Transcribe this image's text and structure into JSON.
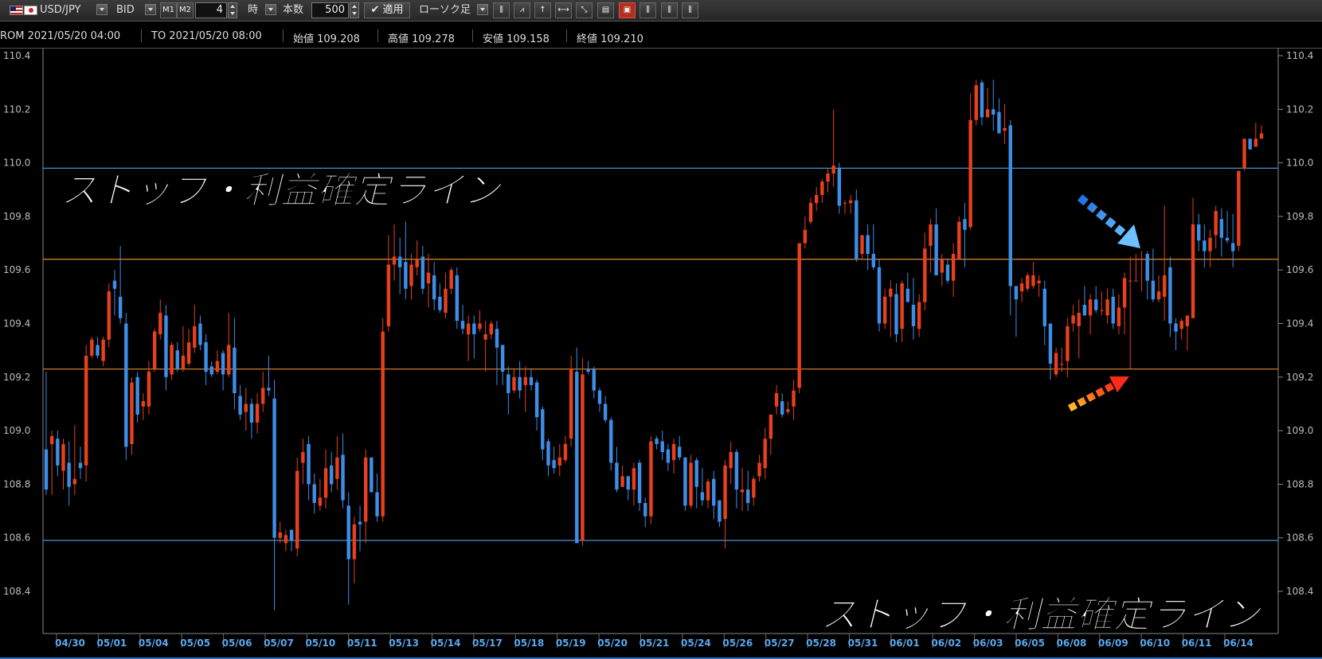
{
  "toolbar": {
    "pair": "USD/JPY",
    "price_type": "BID",
    "m1_label": "M1",
    "m2_label": "M2",
    "period_value": "4",
    "period_unit": "時",
    "count_label": "本数",
    "count_value": "500",
    "apply_label": "✔ 適用",
    "chart_type": "ローソク足"
  },
  "info": {
    "from": "ROM  2021/05/20 04:00",
    "to": "TO  2021/05/20 08:00",
    "open": "始値 109.208",
    "high": "高値 109.278",
    "low": "安値 109.158",
    "close": "終値 109.210"
  },
  "colors": {
    "up": "#e8401c",
    "down": "#3d8ee8",
    "hline_blue": "#4aa6e6",
    "hline_orange": "#e58a2a",
    "axis_text": "#bbbbbb",
    "date_text": "#5aa8ee"
  },
  "chart_data": {
    "type": "candlestick",
    "ylim": [
      108.3,
      110.4
    ],
    "y_ticks": [
      "110.4",
      "110.2",
      "110.0",
      "109.8",
      "109.6",
      "109.4",
      "109.2",
      "109.0",
      "108.8",
      "108.6",
      "108.4"
    ],
    "y_tick_values": [
      110.4,
      110.2,
      110.0,
      109.8,
      109.6,
      109.4,
      109.2,
      109.0,
      108.8,
      108.6,
      108.4
    ],
    "x_labels": [
      "04/30",
      "05/01",
      "05/04",
      "05/05",
      "05/06",
      "05/07",
      "05/10",
      "05/11",
      "05/13",
      "05/14",
      "05/17",
      "05/18",
      "05/19",
      "05/20",
      "05/21",
      "05/24",
      "05/26",
      "05/27",
      "05/28",
      "05/31",
      "06/01",
      "06/02",
      "06/03",
      "06/05",
      "06/08",
      "06/09",
      "06/10",
      "06/11",
      "06/14"
    ],
    "hlines": [
      {
        "y": 109.98,
        "color": "blue"
      },
      {
        "y": 109.64,
        "color": "orange"
      },
      {
        "y": 109.23,
        "color": "orange"
      },
      {
        "y": 108.59,
        "color": "blue"
      }
    ],
    "annotations": [
      {
        "text": "ストップ・利益確定ライン",
        "position": "top-left"
      },
      {
        "text": "ストップ・利益確定ライン",
        "position": "bottom-right"
      }
    ],
    "candles": [
      [
        108.93,
        108.78,
        109.22,
        108.76
      ],
      [
        108.95,
        108.98,
        109.0,
        108.76
      ],
      [
        108.97,
        108.87,
        109.0,
        108.83
      ],
      [
        108.85,
        108.95,
        108.97,
        108.78
      ],
      [
        108.88,
        108.79,
        108.96,
        108.72
      ],
      [
        108.8,
        108.82,
        109.02,
        108.76
      ],
      [
        108.88,
        108.86,
        108.94,
        108.82
      ],
      [
        108.87,
        109.28,
        109.32,
        108.81
      ],
      [
        109.28,
        109.34,
        109.35,
        109.27
      ],
      [
        109.32,
        109.28,
        109.35,
        109.27
      ],
      [
        109.26,
        109.34,
        109.35,
        109.24
      ],
      [
        109.34,
        109.52,
        109.55,
        109.31
      ],
      [
        109.56,
        109.53,
        109.6,
        109.43
      ],
      [
        109.5,
        109.42,
        109.69,
        109.4
      ],
      [
        109.4,
        108.94,
        109.44,
        108.89
      ],
      [
        108.95,
        109.18,
        109.2,
        108.91
      ],
      [
        109.2,
        109.06,
        109.22,
        109.03
      ],
      [
        109.09,
        109.11,
        109.14,
        109.04
      ],
      [
        109.09,
        109.22,
        109.26,
        109.06
      ],
      [
        109.23,
        109.37,
        109.38,
        109.22
      ],
      [
        109.36,
        109.44,
        109.49,
        109.34
      ],
      [
        109.43,
        109.2,
        109.47,
        109.15
      ],
      [
        109.21,
        109.32,
        109.33,
        109.19
      ],
      [
        109.3,
        109.23,
        109.33,
        109.22
      ],
      [
        109.23,
        109.28,
        109.39,
        109.22
      ],
      [
        109.25,
        109.33,
        109.38,
        109.24
      ],
      [
        109.31,
        109.39,
        109.47,
        109.29
      ],
      [
        109.4,
        109.32,
        109.43,
        109.3
      ],
      [
        109.33,
        109.22,
        109.36,
        109.17
      ],
      [
        109.24,
        109.21,
        109.26,
        109.2
      ],
      [
        109.22,
        109.26,
        109.3,
        109.21
      ],
      [
        109.29,
        109.21,
        109.3,
        109.15
      ],
      [
        109.21,
        109.32,
        109.44,
        109.2
      ],
      [
        109.31,
        109.14,
        109.42,
        109.08
      ],
      [
        109.13,
        109.06,
        109.17,
        109.04
      ],
      [
        109.07,
        109.1,
        109.16,
        109.0
      ],
      [
        109.1,
        109.03,
        109.12,
        108.97
      ],
      [
        109.03,
        109.1,
        109.14,
        108.99
      ],
      [
        109.1,
        109.16,
        109.22,
        109.07
      ],
      [
        109.16,
        109.15,
        109.28,
        109.13
      ],
      [
        109.12,
        108.6,
        109.19,
        108.33
      ],
      [
        108.6,
        108.62,
        108.66,
        108.58
      ],
      [
        108.58,
        108.61,
        108.63,
        108.55
      ],
      [
        108.63,
        108.59,
        108.63,
        108.55
      ],
      [
        108.56,
        108.85,
        108.9,
        108.53
      ],
      [
        108.88,
        108.92,
        108.97,
        108.8
      ],
      [
        108.95,
        108.8,
        108.98,
        108.74
      ],
      [
        108.8,
        108.73,
        108.84,
        108.69
      ],
      [
        108.72,
        108.75,
        108.82,
        108.7
      ],
      [
        108.75,
        108.86,
        108.93,
        108.71
      ],
      [
        108.87,
        108.8,
        108.92,
        108.77
      ],
      [
        108.82,
        108.9,
        108.98,
        108.78
      ],
      [
        108.91,
        108.74,
        108.99,
        108.71
      ],
      [
        108.72,
        108.52,
        108.77,
        108.35
      ],
      [
        108.52,
        108.65,
        108.68,
        108.43
      ],
      [
        108.66,
        108.65,
        108.72,
        108.55
      ],
      [
        108.66,
        108.9,
        108.93,
        108.58
      ],
      [
        108.9,
        108.77,
        108.9,
        108.77
      ],
      [
        108.77,
        108.68,
        108.84,
        108.66
      ],
      [
        108.68,
        109.37,
        109.42,
        108.66
      ],
      [
        109.39,
        109.62,
        109.73,
        109.37
      ],
      [
        109.62,
        109.65,
        109.77,
        109.56
      ],
      [
        109.65,
        109.61,
        109.72,
        109.51
      ],
      [
        109.63,
        109.53,
        109.78,
        109.49
      ],
      [
        109.54,
        109.62,
        109.66,
        109.49
      ],
      [
        109.61,
        109.64,
        109.71,
        109.58
      ],
      [
        109.65,
        109.53,
        109.69,
        109.51
      ],
      [
        109.55,
        109.59,
        109.66,
        109.46
      ],
      [
        109.58,
        109.49,
        109.63,
        109.45
      ],
      [
        109.5,
        109.45,
        109.55,
        109.44
      ],
      [
        109.44,
        109.53,
        109.59,
        109.42
      ],
      [
        109.53,
        109.6,
        109.61,
        109.51
      ],
      [
        109.58,
        109.41,
        109.61,
        109.38
      ],
      [
        109.41,
        109.38,
        109.47,
        109.36
      ],
      [
        109.36,
        109.4,
        109.43,
        109.26
      ],
      [
        109.4,
        109.36,
        109.43,
        109.27
      ],
      [
        109.38,
        109.4,
        109.45,
        109.37
      ],
      [
        109.34,
        109.36,
        109.41,
        109.22
      ],
      [
        109.36,
        109.4,
        109.41,
        109.34
      ],
      [
        109.38,
        109.31,
        109.41,
        109.17
      ],
      [
        109.32,
        109.22,
        109.31,
        109.17
      ],
      [
        109.21,
        109.14,
        109.24,
        109.06
      ],
      [
        109.15,
        109.2,
        109.23,
        109.14
      ],
      [
        109.2,
        109.15,
        109.26,
        109.12
      ],
      [
        109.17,
        109.2,
        109.24,
        109.07
      ],
      [
        109.2,
        109.17,
        109.23,
        109.15
      ],
      [
        109.18,
        109.05,
        109.19,
        109.0
      ],
      [
        109.08,
        108.93,
        109.09,
        108.89
      ],
      [
        108.96,
        108.87,
        108.97,
        108.83
      ],
      [
        108.89,
        108.86,
        108.94,
        108.84
      ],
      [
        108.87,
        108.9,
        108.95,
        108.83
      ],
      [
        108.89,
        108.95,
        108.98,
        108.88
      ],
      [
        108.97,
        109.23,
        109.28,
        108.94
      ],
      [
        109.22,
        108.58,
        109.31,
        108.59
      ],
      [
        108.59,
        109.21,
        109.27,
        108.57
      ],
      [
        109.23,
        109.22,
        109.26,
        109.21
      ],
      [
        109.23,
        109.15,
        109.24,
        109.12
      ],
      [
        109.15,
        109.1,
        109.16,
        109.07
      ],
      [
        109.1,
        109.04,
        109.13,
        109.03
      ],
      [
        109.04,
        108.88,
        109.05,
        108.85
      ],
      [
        108.88,
        108.78,
        108.94,
        108.77
      ],
      [
        108.79,
        108.83,
        108.87,
        108.79
      ],
      [
        108.83,
        108.78,
        108.83,
        108.74
      ],
      [
        108.78,
        108.86,
        108.88,
        108.72
      ],
      [
        108.88,
        108.73,
        108.89,
        108.7
      ],
      [
        108.73,
        108.68,
        108.75,
        108.64
      ],
      [
        108.68,
        108.96,
        108.98,
        108.65
      ],
      [
        108.97,
        108.95,
        108.98,
        108.93
      ],
      [
        108.96,
        108.92,
        109.0,
        108.89
      ],
      [
        108.93,
        108.88,
        108.95,
        108.85
      ],
      [
        108.89,
        108.95,
        108.97,
        108.84
      ],
      [
        108.94,
        108.9,
        108.98,
        108.89
      ],
      [
        108.9,
        108.72,
        108.9,
        108.7
      ],
      [
        108.72,
        108.88,
        108.91,
        108.71
      ],
      [
        108.89,
        108.79,
        108.9,
        108.71
      ],
      [
        108.77,
        108.74,
        108.86,
        108.72
      ],
      [
        108.74,
        108.81,
        108.82,
        108.71
      ],
      [
        108.82,
        108.72,
        108.85,
        108.67
      ],
      [
        108.74,
        108.66,
        108.74,
        108.64
      ],
      [
        108.67,
        108.87,
        108.89,
        108.56
      ],
      [
        108.86,
        108.92,
        108.96,
        108.8
      ],
      [
        108.92,
        108.78,
        108.93,
        108.71
      ],
      [
        108.77,
        108.78,
        108.86,
        108.7
      ],
      [
        108.78,
        108.73,
        108.85,
        108.7
      ],
      [
        108.75,
        108.82,
        108.83,
        108.72
      ],
      [
        108.83,
        108.88,
        108.91,
        108.81
      ],
      [
        108.86,
        108.97,
        109.01,
        108.82
      ],
      [
        108.97,
        109.06,
        109.06,
        108.91
      ],
      [
        109.09,
        109.14,
        109.17,
        109.06
      ],
      [
        109.11,
        109.06,
        109.14,
        109.05
      ],
      [
        109.07,
        109.08,
        109.11,
        109.06
      ],
      [
        109.09,
        109.15,
        109.19,
        109.04
      ],
      [
        109.16,
        109.7,
        109.7,
        109.14
      ],
      [
        109.7,
        109.75,
        109.8,
        109.68
      ],
      [
        109.78,
        109.85,
        109.87,
        109.77
      ],
      [
        109.85,
        109.88,
        109.91,
        109.82
      ],
      [
        109.88,
        109.93,
        109.94,
        109.85
      ],
      [
        109.93,
        109.96,
        109.98,
        109.89
      ],
      [
        109.96,
        109.99,
        110.2,
        109.91
      ],
      [
        109.98,
        109.84,
        110.0,
        109.81
      ],
      [
        109.85,
        109.85,
        109.86,
        109.81
      ],
      [
        109.85,
        109.86,
        109.88,
        109.81
      ],
      [
        109.86,
        109.64,
        109.9,
        109.63
      ],
      [
        109.66,
        109.73,
        109.73,
        109.64
      ],
      [
        109.73,
        109.66,
        109.77,
        109.6
      ],
      [
        109.66,
        109.61,
        109.77,
        109.6
      ],
      [
        109.61,
        109.4,
        109.64,
        109.37
      ],
      [
        109.4,
        109.5,
        109.53,
        109.38
      ],
      [
        109.5,
        109.53,
        109.56,
        109.35
      ],
      [
        109.51,
        109.36,
        109.55,
        109.33
      ],
      [
        109.38,
        109.55,
        109.56,
        109.33
      ],
      [
        109.53,
        109.48,
        109.59,
        109.48
      ],
      [
        109.47,
        109.39,
        109.57,
        109.34
      ],
      [
        109.38,
        109.48,
        109.51,
        109.35
      ],
      [
        109.48,
        109.68,
        109.74,
        109.45
      ],
      [
        109.69,
        109.77,
        109.79,
        109.59
      ],
      [
        109.77,
        109.58,
        109.83,
        109.58
      ],
      [
        109.59,
        109.64,
        109.66,
        109.54
      ],
      [
        109.62,
        109.56,
        109.64,
        109.55
      ],
      [
        109.56,
        109.66,
        109.7,
        109.5
      ],
      [
        109.64,
        109.78,
        109.8,
        109.64
      ],
      [
        109.79,
        109.75,
        109.85,
        109.61
      ],
      [
        109.76,
        110.16,
        110.26,
        109.75
      ],
      [
        110.16,
        110.29,
        110.31,
        110.14
      ],
      [
        110.3,
        110.17,
        110.31,
        110.14
      ],
      [
        110.17,
        110.2,
        110.28,
        110.17
      ],
      [
        110.2,
        110.18,
        110.31,
        110.12
      ],
      [
        110.19,
        110.11,
        110.24,
        110.13
      ],
      [
        110.12,
        110.13,
        110.22,
        110.07
      ],
      [
        110.14,
        109.54,
        110.16,
        109.43
      ],
      [
        109.54,
        109.49,
        109.53,
        109.35
      ],
      [
        109.52,
        109.55,
        109.57,
        109.48
      ],
      [
        109.53,
        109.58,
        109.59,
        109.52
      ],
      [
        109.54,
        109.58,
        109.63,
        109.53
      ],
      [
        109.55,
        109.56,
        109.58,
        109.5
      ],
      [
        109.53,
        109.39,
        109.56,
        109.32
      ],
      [
        109.4,
        109.25,
        109.4,
        109.19
      ],
      [
        109.21,
        109.29,
        109.31,
        109.2
      ],
      [
        109.25,
        109.25,
        109.31,
        109.22
      ],
      [
        109.26,
        109.39,
        109.42,
        109.2
      ],
      [
        109.4,
        109.43,
        109.47,
        109.37
      ],
      [
        109.39,
        109.44,
        109.49,
        109.27
      ],
      [
        109.47,
        109.43,
        109.54,
        109.43
      ],
      [
        109.43,
        109.49,
        109.51,
        109.36
      ],
      [
        109.49,
        109.45,
        109.54,
        109.44
      ],
      [
        109.45,
        109.45,
        109.52,
        109.43
      ],
      [
        109.43,
        109.49,
        109.53,
        109.4
      ],
      [
        109.5,
        109.4,
        109.53,
        109.38
      ],
      [
        109.39,
        109.46,
        109.51,
        109.36
      ],
      [
        109.46,
        109.57,
        109.59,
        109.36
      ],
      [
        109.56,
        109.56,
        109.65,
        109.23
      ],
      [
        109.56,
        109.56,
        109.66,
        109.56
      ],
      [
        109.64,
        109.64,
        109.67,
        109.52
      ],
      [
        109.66,
        109.56,
        109.67,
        109.49
      ],
      [
        109.56,
        109.49,
        109.68,
        109.48
      ],
      [
        109.49,
        109.52,
        109.58,
        109.48
      ],
      [
        109.5,
        109.58,
        109.84,
        109.41
      ],
      [
        109.61,
        109.4,
        109.65,
        109.35
      ],
      [
        109.4,
        109.37,
        109.42,
        109.3
      ],
      [
        109.38,
        109.41,
        109.42,
        109.34
      ],
      [
        109.39,
        109.43,
        109.43,
        109.3
      ],
      [
        109.42,
        109.77,
        109.87,
        109.42
      ],
      [
        109.77,
        109.71,
        109.81,
        109.67
      ],
      [
        109.71,
        109.67,
        109.77,
        109.61
      ],
      [
        109.67,
        109.72,
        109.75,
        109.61
      ],
      [
        109.73,
        109.82,
        109.84,
        109.68
      ],
      [
        109.79,
        109.72,
        109.83,
        109.65
      ],
      [
        109.72,
        109.71,
        109.82,
        109.7
      ],
      [
        109.7,
        109.67,
        109.81,
        109.61
      ],
      [
        109.69,
        109.97,
        109.97,
        109.67
      ],
      [
        109.98,
        110.09,
        110.09,
        109.97
      ],
      [
        110.09,
        110.05,
        110.09,
        110.05
      ],
      [
        110.06,
        110.09,
        110.15,
        110.06
      ],
      [
        110.09,
        110.11,
        110.14,
        110.09
      ]
    ]
  }
}
